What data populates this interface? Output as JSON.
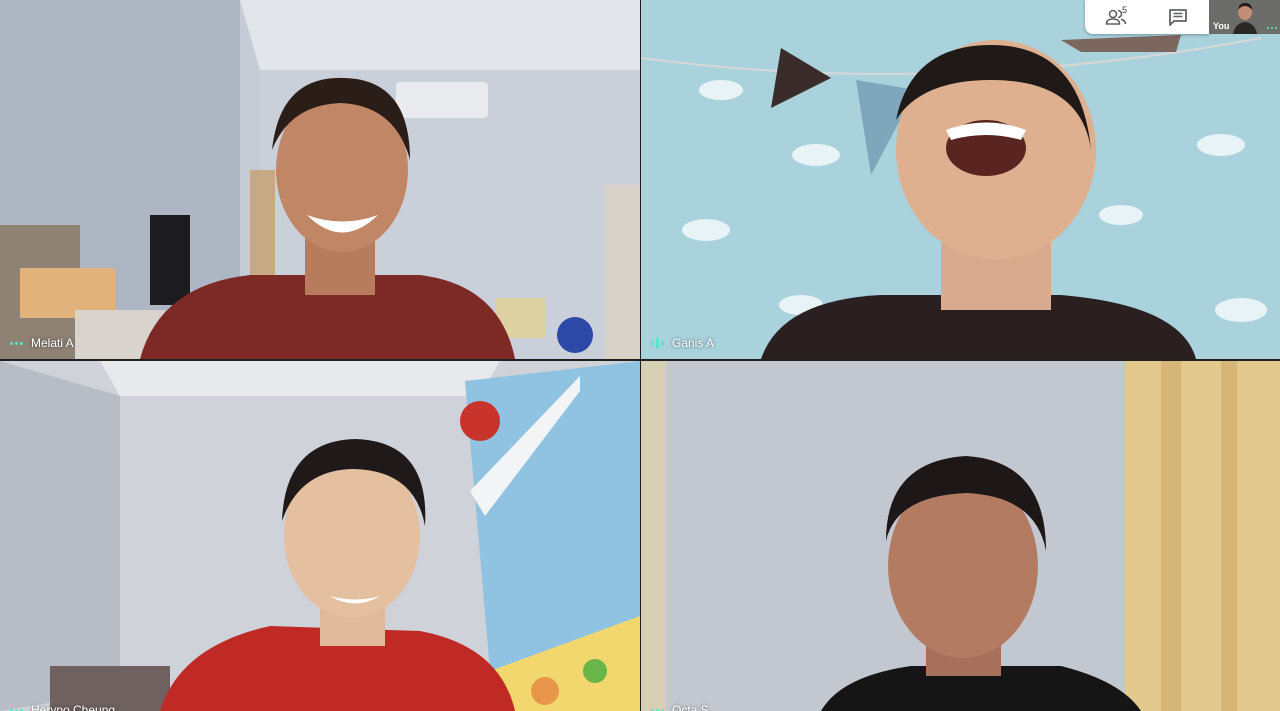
{
  "participants": [
    {
      "name": "Melati A",
      "status_icon": "dots-icon"
    },
    {
      "name": "Ganis A",
      "status_icon": "speaking-icon"
    },
    {
      "name": "Heryno Cheung",
      "status_icon": "dots-icon"
    },
    {
      "name": "Octa S",
      "status_icon": "dots-icon"
    }
  ],
  "top_panel": {
    "people_count": "5",
    "self_label": "You",
    "people_icon": "people-icon",
    "chat_icon": "chat-icon"
  },
  "colors": {
    "status_accent": "#5ee5c9",
    "panel_bg": "#ffffff"
  }
}
